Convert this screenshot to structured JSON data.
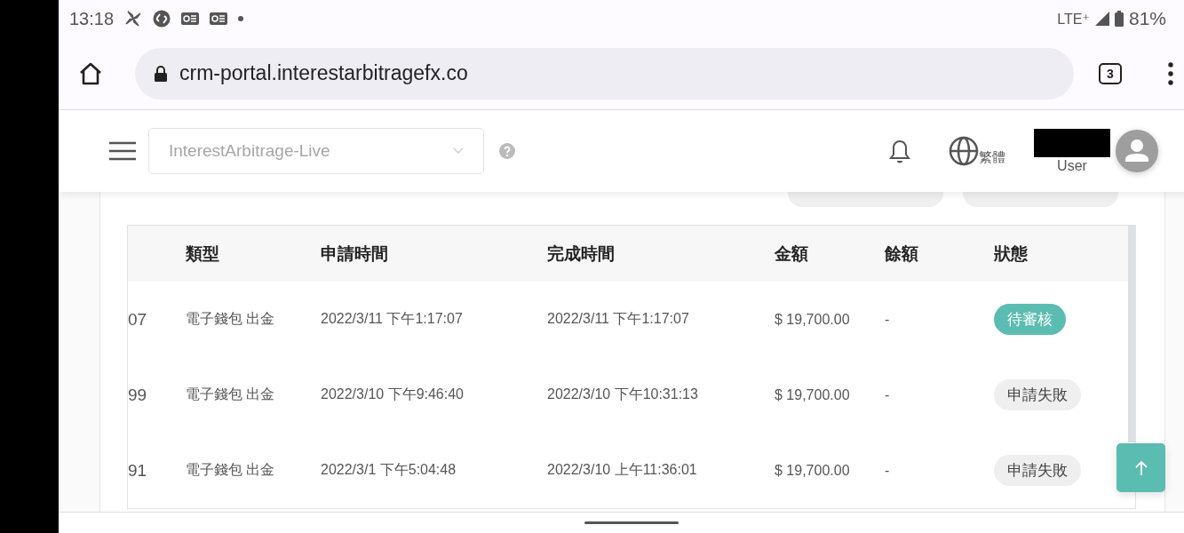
{
  "status_bar": {
    "time": "13:18",
    "network": "LTE⁺",
    "battery": "81%"
  },
  "browser": {
    "url": "crm-portal.interestarbitragefx.co",
    "tab_count": "3"
  },
  "header": {
    "account_select": {
      "placeholder": "InterestArbitrage-Live"
    },
    "language": "繁體",
    "user_label": "User"
  },
  "table": {
    "columns": [
      "",
      "類型",
      "申請時間",
      "完成時間",
      "金額",
      "餘額",
      "狀態"
    ],
    "rows": [
      {
        "id": "07",
        "type": "電子錢包 出金",
        "requested": "2022/3/11 下午1:17:07",
        "completed": "2022/3/11 下午1:17:07",
        "amount": "$ 19,700.00",
        "balance": "-",
        "status": {
          "label": "待審核",
          "kind": "pending"
        }
      },
      {
        "id": "99",
        "type": "電子錢包 出金",
        "requested": "2022/3/10 下午9:46:40",
        "completed": "2022/3/10 下午10:31:13",
        "amount": "$ 19,700.00",
        "balance": "-",
        "status": {
          "label": "申請失敗",
          "kind": "failed"
        }
      },
      {
        "id": "91",
        "type": "電子錢包 出金",
        "requested": "2022/3/1 下午5:04:48",
        "completed": "2022/3/10 上午11:36:01",
        "amount": "$ 19,700.00",
        "balance": "-",
        "status": {
          "label": "申請失敗",
          "kind": "failed"
        }
      }
    ]
  }
}
